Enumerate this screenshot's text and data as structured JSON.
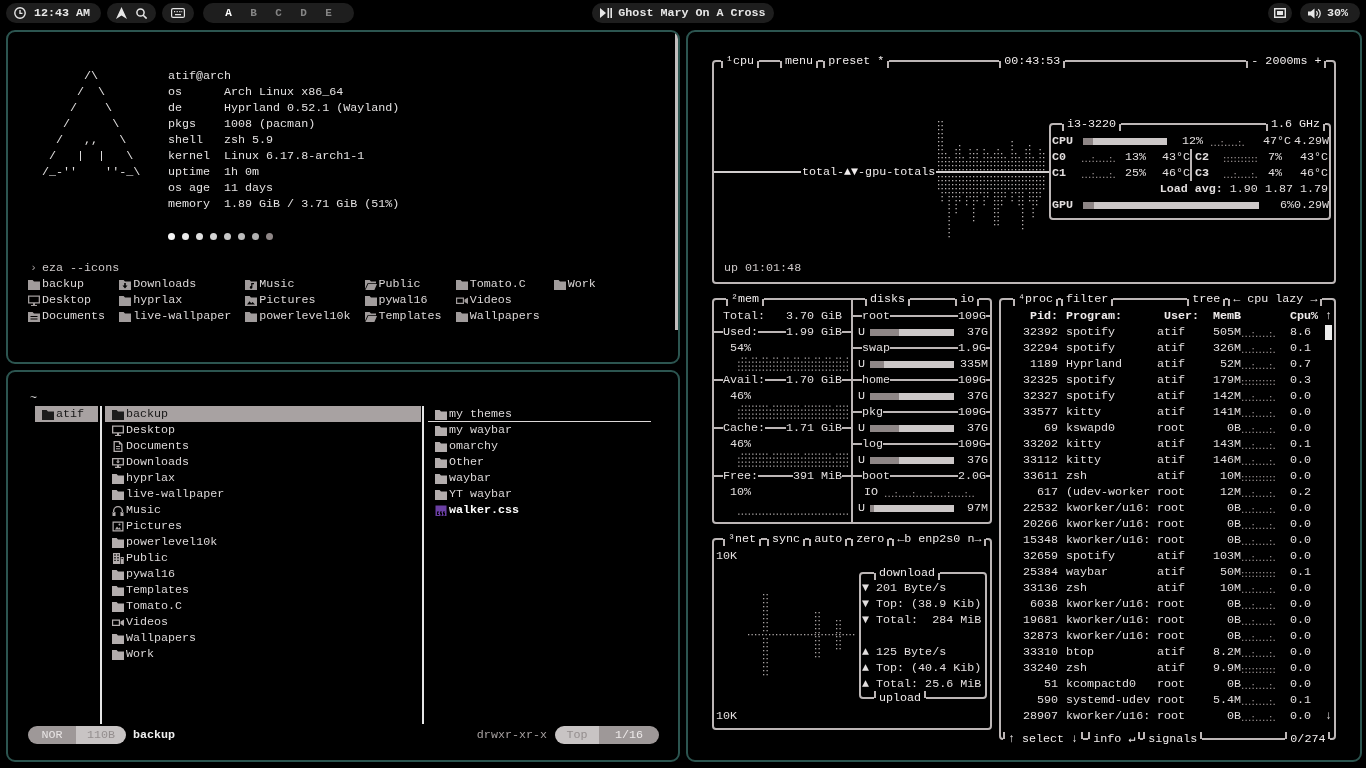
{
  "top_bar": {
    "clock": "12:43 AM",
    "workspaces": [
      {
        "label": "A",
        "selected": true
      },
      {
        "label": "B",
        "selected": false
      },
      {
        "label": "C",
        "selected": false
      },
      {
        "label": "D",
        "selected": false
      },
      {
        "label": "E",
        "selected": false
      }
    ],
    "media_title": "Ghost Mary On A Cross",
    "volume": "30%"
  },
  "fastfetch": {
    "logo": [
      "      /\\",
      "     /  \\",
      "    /    \\",
      "   /      \\",
      "  /   ,,   \\",
      " /   |  |   \\",
      "/_-''    ''-_\\"
    ],
    "title": "atif@arch",
    "fields": [
      {
        "key": "os",
        "value": "Arch Linux x86_64"
      },
      {
        "key": "de",
        "value": "Hyprland 0.52.1 (Wayland)"
      },
      {
        "key": "pkgs",
        "value": "1008 (pacman)"
      },
      {
        "key": "shell",
        "value": "zsh 5.9"
      },
      {
        "key": "kernel",
        "value": "Linux 6.17.8-arch1-1"
      },
      {
        "key": "uptime",
        "value": "1h 0m"
      },
      {
        "key": "os age",
        "value": "11 days"
      },
      {
        "key": "memory",
        "value": "1.89 GiB / 3.71 GiB (51%)"
      }
    ],
    "palette": [
      {
        "color": "#f5f5f5"
      },
      {
        "color": "#ebebeb"
      },
      {
        "color": "#e0e0e0"
      },
      {
        "color": "#d4d4d4"
      },
      {
        "color": "#c8c8c8"
      },
      {
        "color": "#bcbcbc"
      },
      {
        "color": "#b0b0b0"
      },
      {
        "color": "#8f8787"
      }
    ]
  },
  "shell": {
    "prompt": "›",
    "command": "eza --icons",
    "entries": [
      {
        "name": "backup",
        "kind": "folder"
      },
      {
        "name": "Desktop",
        "kind": "monitor"
      },
      {
        "name": "Documents",
        "kind": "docfolder"
      },
      {
        "name": "Downloads",
        "kind": "downfolder"
      },
      {
        "name": "hyprlax",
        "kind": "folder"
      },
      {
        "name": "live-wallpaper",
        "kind": "folder"
      },
      {
        "name": "Music",
        "kind": "musicfolder"
      },
      {
        "name": "Pictures",
        "kind": "imagefolder"
      },
      {
        "name": "powerlevel10k",
        "kind": "folder"
      },
      {
        "name": "Public",
        "kind": "openfolder"
      },
      {
        "name": "pywal16",
        "kind": "folder"
      },
      {
        "name": "Templates",
        "kind": "openfolder"
      },
      {
        "name": "Tomato.C",
        "kind": "folder"
      },
      {
        "name": "Videos",
        "kind": "camera"
      },
      {
        "name": "Wallpapers",
        "kind": "folder"
      },
      {
        "name": "Work",
        "kind": "folder"
      }
    ]
  },
  "file_manager": {
    "path": "~",
    "parent": [
      {
        "name": "atif",
        "kind": "folder",
        "selected": true
      }
    ],
    "current": [
      {
        "name": "backup",
        "kind": "folder",
        "selected": true
      },
      {
        "name": "Desktop",
        "kind": "monitor",
        "selected": false
      },
      {
        "name": "Documents",
        "kind": "document",
        "selected": false
      },
      {
        "name": "Downloads",
        "kind": "download",
        "selected": false
      },
      {
        "name": "hyprlax",
        "kind": "folder",
        "selected": false
      },
      {
        "name": "live-wallpaper",
        "kind": "folder",
        "selected": false
      },
      {
        "name": "Music",
        "kind": "headphones",
        "selected": false
      },
      {
        "name": "Pictures",
        "kind": "image",
        "selected": false
      },
      {
        "name": "powerlevel10k",
        "kind": "folder",
        "selected": false
      },
      {
        "name": "Public",
        "kind": "building",
        "selected": false
      },
      {
        "name": "pywal16",
        "kind": "folder",
        "selected": false
      },
      {
        "name": "Templates",
        "kind": "folder",
        "selected": false
      },
      {
        "name": "Tomato.C",
        "kind": "folder",
        "selected": false
      },
      {
        "name": "Videos",
        "kind": "camera",
        "selected": false
      },
      {
        "name": "Wallpapers",
        "kind": "folder",
        "selected": false
      },
      {
        "name": "Work",
        "kind": "folder",
        "selected": false
      }
    ],
    "preview": [
      {
        "name": "my themes",
        "kind": "folder",
        "selected": true
      },
      {
        "name": "my waybar",
        "kind": "folder",
        "selected": false
      },
      {
        "name": "omarchy",
        "kind": "folder",
        "selected": false
      },
      {
        "name": "Other",
        "kind": "folder",
        "selected": false
      },
      {
        "name": "waybar",
        "kind": "folder",
        "selected": false
      },
      {
        "name": "YT waybar",
        "kind": "folder",
        "selected": false
      },
      {
        "name": "walker.css",
        "kind": "css",
        "selected": false
      }
    ],
    "status": {
      "mode": "NOR",
      "size": "110B",
      "name": "backup",
      "permissions": "drwxr-xr-x",
      "position": "Top",
      "count": "1/16"
    }
  },
  "btop": {
    "cpu": {
      "title": "¹cpu",
      "menu": "menu",
      "preset": "preset *",
      "clock": "00:43:53",
      "interval": "- 2000ms +",
      "graph_label": "total-▲▼-gpu-totals",
      "uptime": "up 01:01:48",
      "model": "i3-3220",
      "frequency": "1.6 GHz",
      "total": {
        "label": "CPU",
        "level": 0.12,
        "percent": "12%",
        "temp": "47°C",
        "power": "4.29W"
      },
      "cores": [
        {
          "label": "C0",
          "percent": "13%",
          "temp": "43°C"
        },
        {
          "label": "C2",
          "percent": "7%",
          "temp": "43°C"
        },
        {
          "label": "C1",
          "percent": "25%",
          "temp": "46°C"
        },
        {
          "label": "C3",
          "percent": "4%",
          "temp": "46°C"
        }
      ],
      "load_label": "Load avg:",
      "load": [
        "1.90",
        "1.87",
        "1.79"
      ],
      "gpu": {
        "label": "GPU",
        "level": 0.06,
        "percent": "6%",
        "power": "0.29W"
      }
    },
    "mem": {
      "title": "²mem",
      "rows": [
        {
          "label": "Total:",
          "value": "3.70 GiB"
        },
        {
          "label": "Used:",
          "value": "1.99 GiB",
          "percent": "54%"
        },
        {
          "label": "Avail:",
          "value": "1.70 GiB",
          "percent": "46%"
        },
        {
          "label": "Cache:",
          "value": "1.71 GiB",
          "percent": "46%"
        },
        {
          "label": "Free:",
          "value": "391 MiB",
          "percent": "10%"
        }
      ]
    },
    "disks": {
      "title": "disks",
      "io_title": "io",
      "items": [
        {
          "name": "root",
          "size": "109G",
          "used_label": "U",
          "level": 0.34,
          "used": "37G"
        },
        {
          "name": "swap",
          "size": "1.9G",
          "used_label": "U",
          "level": 0.17,
          "used": "335M"
        },
        {
          "name": "home",
          "size": "109G",
          "used_label": "U",
          "level": 0.34,
          "used": "37G"
        },
        {
          "name": "pkg",
          "size": "109G",
          "used_label": "U",
          "level": 0.34,
          "used": "37G"
        },
        {
          "name": "log",
          "size": "109G",
          "used_label": "U",
          "level": 0.34,
          "used": "37G"
        },
        {
          "name": "boot",
          "size": "2.0G",
          "io_label": "IO",
          "used_label": "U",
          "level": 0.05,
          "used": "97M"
        }
      ]
    },
    "net": {
      "title": "³net",
      "toggles": [
        "sync",
        "auto",
        "zero"
      ],
      "interface": "←b enp2s0 n→",
      "scale_top": "10K",
      "download_title": "download",
      "download": [
        "▼ 201 Byte/s",
        "▼ Top: (38.9 Kib)",
        "▼ Total:  284 MiB"
      ],
      "upload": [
        "▲ 125 Byte/s",
        "▲ Top: (40.4 Kib)",
        "▲ Total: 25.6 MiB"
      ],
      "upload_title": "upload",
      "scale_bottom": "10K"
    },
    "proc": {
      "title": "⁴proc",
      "filter": "filter",
      "tree": "tree",
      "sorting": "← cpu lazy →",
      "columns": [
        "Pid:",
        "Program:",
        "User:",
        "MemB",
        "Cpu%"
      ],
      "scroll_up": "↑",
      "rows": [
        {
          "pid": "32392",
          "program": "spotify",
          "user": "atif",
          "mem": "505M",
          "cpu": "8.6"
        },
        {
          "pid": "32294",
          "program": "spotify",
          "user": "atif",
          "mem": "326M",
          "cpu": "0.1"
        },
        {
          "pid": "1189",
          "program": "Hyprland",
          "user": "atif",
          "mem": "52M",
          "cpu": "0.7"
        },
        {
          "pid": "32325",
          "program": "spotify",
          "user": "atif",
          "mem": "179M",
          "cpu": "0.3"
        },
        {
          "pid": "32327",
          "program": "spotify",
          "user": "atif",
          "mem": "142M",
          "cpu": "0.0"
        },
        {
          "pid": "33577",
          "program": "kitty",
          "user": "atif",
          "mem": "141M",
          "cpu": "0.0"
        },
        {
          "pid": "69",
          "program": "kswapd0",
          "user": "root",
          "mem": "0B",
          "cpu": "0.0"
        },
        {
          "pid": "33202",
          "program": "kitty",
          "user": "atif",
          "mem": "143M",
          "cpu": "0.1"
        },
        {
          "pid": "33112",
          "program": "kitty",
          "user": "atif",
          "mem": "146M",
          "cpu": "0.0"
        },
        {
          "pid": "33611",
          "program": "zsh",
          "user": "atif",
          "mem": "10M",
          "cpu": "0.0"
        },
        {
          "pid": "617",
          "program": "(udev-worker",
          "user": "root",
          "mem": "12M",
          "cpu": "0.2"
        },
        {
          "pid": "22532",
          "program": "kworker/u16:",
          "user": "root",
          "mem": "0B",
          "cpu": "0.0"
        },
        {
          "pid": "20266",
          "program": "kworker/u16:",
          "user": "root",
          "mem": "0B",
          "cpu": "0.0"
        },
        {
          "pid": "15348",
          "program": "kworker/u16:",
          "user": "root",
          "mem": "0B",
          "cpu": "0.0"
        },
        {
          "pid": "32659",
          "program": "spotify",
          "user": "atif",
          "mem": "103M",
          "cpu": "0.0"
        },
        {
          "pid": "25384",
          "program": "waybar",
          "user": "atif",
          "mem": "50M",
          "cpu": "0.1"
        },
        {
          "pid": "33136",
          "program": "zsh",
          "user": "atif",
          "mem": "10M",
          "cpu": "0.0"
        },
        {
          "pid": "6038",
          "program": "kworker/u16:",
          "user": "root",
          "mem": "0B",
          "cpu": "0.0"
        },
        {
          "pid": "19681",
          "program": "kworker/u16:",
          "user": "root",
          "mem": "0B",
          "cpu": "0.0"
        },
        {
          "pid": "32873",
          "program": "kworker/u16:",
          "user": "root",
          "mem": "0B",
          "cpu": "0.0"
        },
        {
          "pid": "33310",
          "program": "btop",
          "user": "atif",
          "mem": "8.2M",
          "cpu": "0.0"
        },
        {
          "pid": "33240",
          "program": "zsh",
          "user": "atif",
          "mem": "9.9M",
          "cpu": "0.0"
        },
        {
          "pid": "51",
          "program": "kcompactd0",
          "user": "root",
          "mem": "0B",
          "cpu": "0.0"
        },
        {
          "pid": "590",
          "program": "systemd-udev",
          "user": "root",
          "mem": "5.4M",
          "cpu": "0.1"
        },
        {
          "pid": "28907",
          "program": "kworker/u16:",
          "user": "root",
          "mem": "0B",
          "cpu": "0.0"
        }
      ],
      "scroll_down": "↓",
      "footer": [
        "↑ select ↓",
        "info ↵",
        "signals"
      ],
      "count": "0/274"
    }
  }
}
